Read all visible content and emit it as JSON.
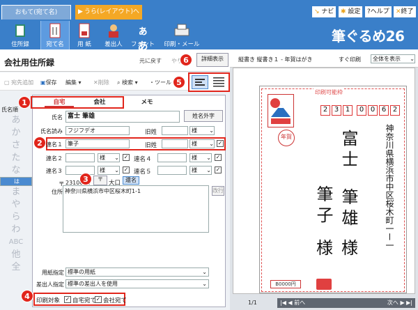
{
  "top_tabs": {
    "omote": "おもて(宛て名)",
    "ura": "うら(レイアウト)へ切替",
    "ura_arrow": "▶"
  },
  "top_links": {
    "navi": "ナビ",
    "settings": "設定",
    "help": "?ヘルプ",
    "exit": "終了"
  },
  "tools": {
    "address_book": "住所録",
    "recipient": "宛て名",
    "paper": "用 紙",
    "sender": "差出人",
    "font": "フォント",
    "font_glyph": "ぁあ",
    "print_mail": "印刷・メール"
  },
  "brand": "筆ぐるめ26",
  "page": {
    "title": "会社用住所録",
    "back": "元に戻す",
    "redo": "やり直",
    "detail_button": "詳細表示"
  },
  "actions": {
    "add": "宛先追加",
    "save": "保存",
    "edit": "編集",
    "delete": "削除",
    "search": "検索",
    "tool": "ツール"
  },
  "callouts": {
    "c1": "1",
    "c2": "2",
    "c3": "3",
    "c4": "4",
    "c5": "5",
    "c6": "6"
  },
  "index": {
    "label": "氏名順",
    "rows": [
      "あ",
      "か",
      "さ",
      "た",
      "な",
      "は",
      "ま",
      "や",
      "ら",
      "わ",
      "ABC",
      "他",
      "全"
    ],
    "selected": 5
  },
  "form_tabs": {
    "home": "自宅",
    "company": "会社",
    "memo": "メモ"
  },
  "fields": {
    "name_label": "氏名",
    "name_value": "富士 筆雄",
    "gaiji_button": "姓名外字",
    "yomi_label": "氏名読み",
    "yomi_value": "フジフデオ",
    "kyusei_label": "旧姓",
    "honorific": "様",
    "renmei1_label": "連名１",
    "renmei1_value": "筆子",
    "kyusei2_label": "旧姓",
    "honorific2": "様",
    "renmei2_label": "連名２",
    "renmei3_label": "連名３",
    "renmei4_label": "連名４",
    "renmei5_label": "連名５",
    "honorific_2": "様",
    "honorific_3": "様",
    "honorific_4": "様",
    "honorific_5": "様",
    "zip_label": "〒",
    "zip_value": "2310062",
    "zip_button": "〒",
    "oguchi_button": "大口",
    "rename_button": "還名",
    "address_label": "住所",
    "address_value": "神奈川県横浜市中区桜木町1-1",
    "linebreak_button": "改行",
    "paper_label": "用紙指定",
    "paper_value": "標準の用紙",
    "sender_label": "差出人指定",
    "sender_value": "標準の差出人を使用",
    "print_target_label": "印刷対象",
    "home_address": "自宅宛て",
    "company_address": "会社宛て"
  },
  "preview": {
    "header": "縦書き 縦書き１ - 年賀はがき",
    "quick_print": "すぐ印刷",
    "show_all": "全体を表示",
    "printable": "印刷可能枠",
    "zip": [
      "2",
      "3",
      "1",
      "0",
      "0",
      "6",
      "2"
    ],
    "address_col": "神奈川県横浜市中区桜木町一ー一",
    "name1": "富士",
    "name2": "筆雄",
    "honor1": "様",
    "name3": "筆子",
    "honor2": "様",
    "stamp_text": "年賀",
    "value_text": "B0000円",
    "page": "1/1",
    "prev": "前へ",
    "next": "次へ"
  },
  "colors": {
    "accent": "#3a7fc9",
    "callout": "#e1251b",
    "orange": "#f4a825"
  }
}
